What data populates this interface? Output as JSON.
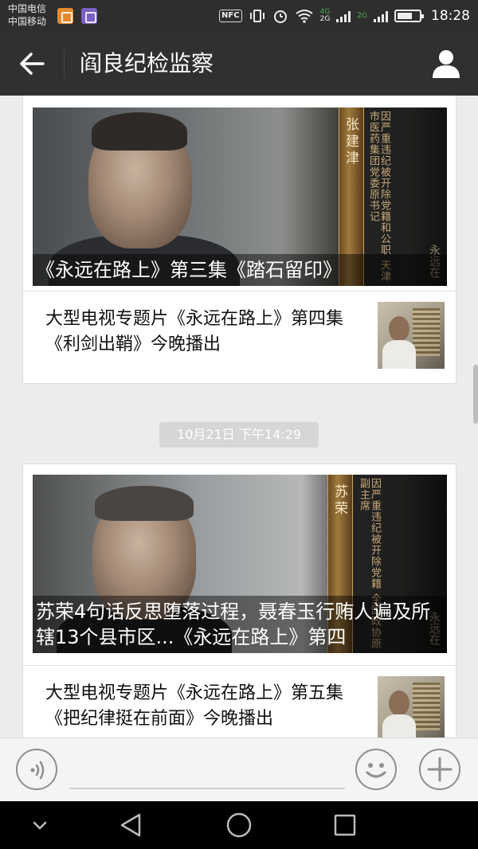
{
  "status_bar": {
    "carrier_1": "中国电信",
    "carrier_2": "中国移动",
    "nfc": "NFC",
    "net_1": "4G",
    "net_2": "2G",
    "time": "18:28"
  },
  "nav": {
    "title": "阎良纪检监察"
  },
  "messages": [
    {
      "cover": {
        "title": "《永远在路上》第三集《踏石留印》",
        "plate_text": "张建津",
        "caption": "因严重违纪被开除党籍和公职 天津市医药集团党委原书记",
        "watermark": "永远在"
      },
      "sub_article": {
        "title": "大型电视专题片《永远在路上》第四集《利剑出鞘》今晚播出"
      }
    },
    {
      "timestamp": "10月21日 下午14:29",
      "cover": {
        "title": "苏荣4句话反思堕落过程，聂春玉行贿人遍及所辖13个县市区...《永远在路上》第四",
        "plate_text": "苏荣",
        "caption": "因严重违纪被开除党籍 全国政协原副主席",
        "watermark": "永远在"
      },
      "sub_article": {
        "title": "大型电视专题片《永远在路上》第五集《把纪律挺在前面》今晚播出"
      }
    }
  ],
  "colors": {
    "nav_bg": "#303030",
    "feed_bg": "#ececec",
    "timestamp_bg": "#d6d6d6"
  },
  "icons": [
    "back-arrow-icon",
    "profile-icon",
    "voice-icon",
    "emoji-icon",
    "plus-icon",
    "hide-keyboard-icon",
    "system-back-icon",
    "system-home-icon",
    "system-recent-icon"
  ]
}
